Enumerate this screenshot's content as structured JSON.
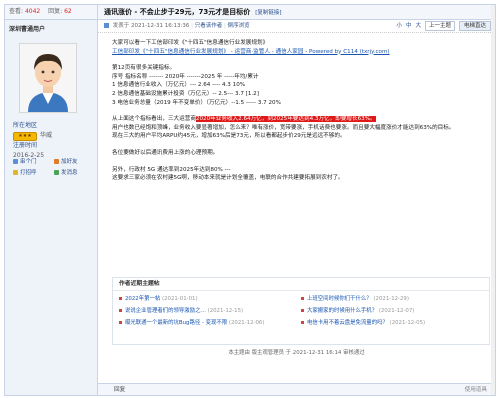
{
  "sidebar": {
    "stats": {
      "views_label": "查看:",
      "views": "4042",
      "replies_label": "回复:",
      "replies": "62"
    },
    "username": "深圳曹通用户",
    "info": {
      "group_key": "所在地区",
      "group_val": "",
      "rank_key": "积分",
      "rank_val": "华威",
      "level_key": "注册时间",
      "date": "2016-2-25"
    },
    "actions": [
      "串个门",
      "加好友",
      "打招呼",
      "发消息"
    ]
  },
  "post": {
    "title": "通讯涨价 - 不会止步于29元，73元才是目标价",
    "copy_link": "[复制链接]",
    "meta": {
      "posted": "发表于 2021-12-31 16:13:36",
      "only_author": "只看该作者",
      "reverse": "倒序浏览"
    },
    "font_small": "小",
    "font_mid": "中",
    "font_large": "大",
    "prev": "上一主题",
    "next": "电梯直达"
  },
  "content": {
    "p1": "大家可以看一下工信部印发《\"十四五\"信息通信行业发展规划》",
    "p1_link": "工信部印发《\"十四五\"信息通信行业发展规划》 - 运营商·监管人 - 通信人家园 - Powered by C114 (txrjy.com)",
    "p2": "第12页有很多关键指标。",
    "p3": "序号  指标名称  -------  2020年  -------2025 年  -----年均/累计",
    "p4": "1 信息通信行业收入（万亿元）--- 2.64 ----    4.3 10%",
    "p5": "2 信息通信基础设施累计投资（万亿元）-- 2.5--- 3.7  [1.2]",
    "p6": "3 电信业务总量（2019 年不变单价）（万亿元）--1.5 ----- 3.7  20%",
    "p7a": "从上面这个指标看出，三大运营商",
    "p7hl": "2020年业务收入2.64万亿，到2025年要达到4.3万亿，即要增长63%。",
    "p8": "用户也数已经饱和顶峰，业务收入要显著增加，怎么来？唯有涨价，宽带要涨，手机话费也要涨。而且要大幅度涨价才能达到63%的目标。",
    "p9": "现在三大的用户平均ARPU约45元，增加63%后是73元，所以看都起步价29元是远远不够的。",
    "p10": "各位要做好以后通讯费用上涨的心理预期。",
    "p11": "另外，行政村 5G 通达率到2025年达到80% ---",
    "p12": "这要求三家必须在农村建5G啊，移动本来就是计划全覆盖，电联的合作共建要拓展到农村了。"
  },
  "recommend": {
    "heading": "作者近期主题帖",
    "items": [
      {
        "title": "2022年第一帖",
        "date": "(2021-01-01)"
      },
      {
        "title": "上班空间时候你们干什么？",
        "date": "(2021-12-29)"
      },
      {
        "title": "说说企业管理者们的领导激励之…",
        "date": "(2021-12-15)"
      },
      {
        "title": "大家搬家的时候用什么手机？",
        "date": "(2021-12-07)"
      },
      {
        "title": "曝光联通一个最新的坑Bug路径 - 变现不限",
        "date": "(2021-12-06)"
      },
      {
        "title": "电信卡用不着云盘是免流量的吗？",
        "date": "(2021-12-05)"
      }
    ]
  },
  "footnote": "本主题由 版主观管理员 于 2021-12-31 16:14 审核通过",
  "reply_bar": {
    "label": "回复",
    "option": "使用道具"
  }
}
